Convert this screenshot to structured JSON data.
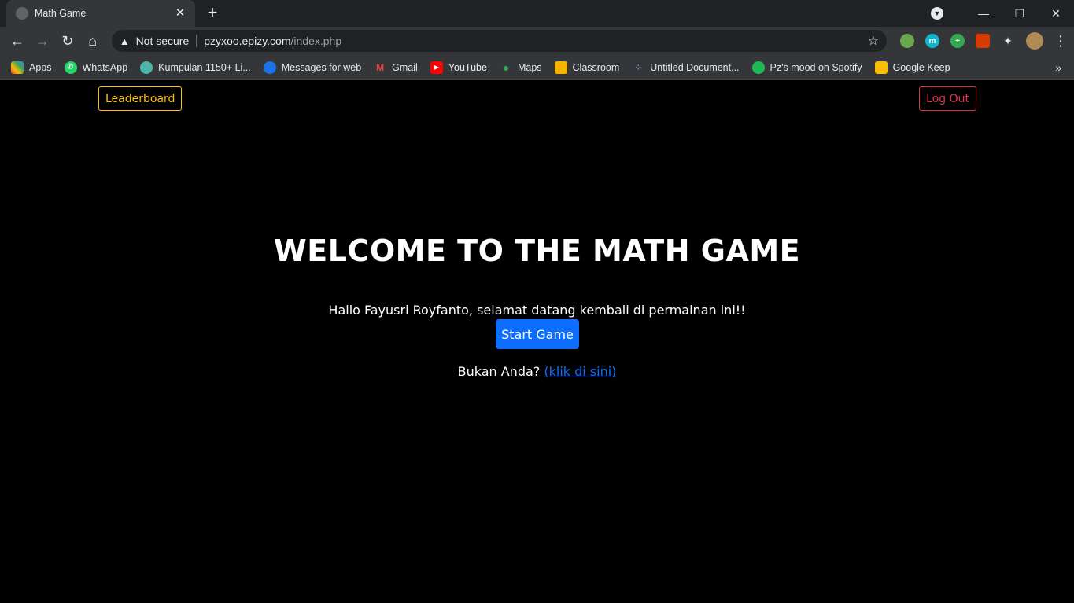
{
  "browser": {
    "tab": {
      "title": "Math Game"
    },
    "address": {
      "security": "Not secure",
      "host": "pzyxoo.epizy.com",
      "path": "/index.php"
    },
    "bookmarks": [
      {
        "label": "Apps",
        "icon": "apps-grid-icon",
        "color": "#ea4335"
      },
      {
        "label": "WhatsApp",
        "icon": "whatsapp-icon",
        "color": "#25d366"
      },
      {
        "label": "Kumpulan 1150+ Li...",
        "icon": "globe-icon",
        "color": "#4db6ac"
      },
      {
        "label": "Messages for web",
        "icon": "messages-icon",
        "color": "#1a73e8"
      },
      {
        "label": "Gmail",
        "icon": "gmail-icon",
        "color": "#ea4335"
      },
      {
        "label": "YouTube",
        "icon": "youtube-icon",
        "color": "#ff0000"
      },
      {
        "label": "Maps",
        "icon": "maps-icon",
        "color": "#34a853"
      },
      {
        "label": "Classroom",
        "icon": "classroom-icon",
        "color": "#f4b400"
      },
      {
        "label": "Untitled Document...",
        "icon": "document-icon",
        "color": "#8ab4f8"
      },
      {
        "label": "Pz's mood on Spotify",
        "icon": "spotify-icon",
        "color": "#1db954"
      },
      {
        "label": "Google Keep",
        "icon": "keep-icon",
        "color": "#fbbc04"
      }
    ]
  },
  "page": {
    "leaderboard_label": "Leaderboard",
    "logout_label": "Log Out",
    "title": "WELCOME TO THE MATH GAME",
    "greeting": "Hallo Fayusri Royfanto, selamat datang kembali di permainan ini!!",
    "start_label": "Start Game",
    "not_you_prefix": "Bukan Anda?",
    "not_you_link": "(klik di sini)",
    "colors": {
      "leaderboard": "#ffc107",
      "logout": "#dc3545",
      "primary": "#0d6efd"
    }
  }
}
